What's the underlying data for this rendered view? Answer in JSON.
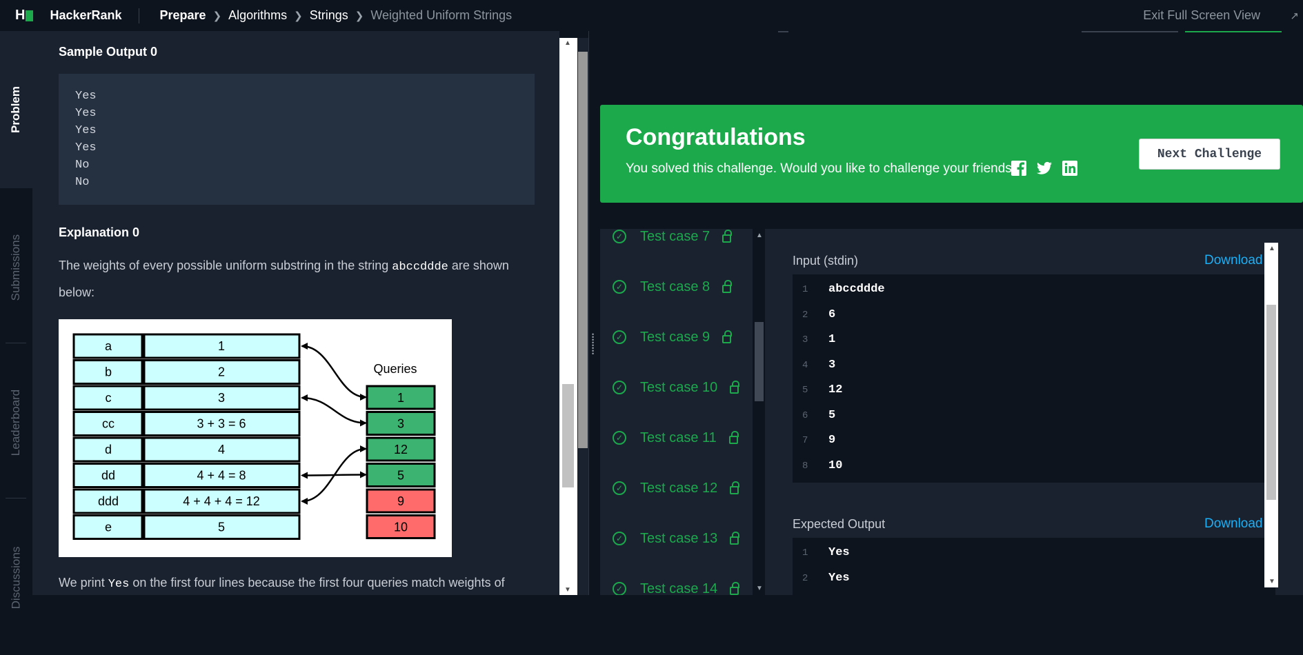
{
  "topbar": {
    "logo_letter": "H",
    "brand": "HackerRank",
    "breadcrumbs": [
      "Prepare",
      "Algorithms",
      "Strings",
      "Weighted Uniform Strings"
    ],
    "exit_fullscreen": "Exit Full Screen View"
  },
  "sidetabs": [
    "Problem",
    "Submissions",
    "Leaderboard",
    "Discussions"
  ],
  "problem": {
    "sample_output_heading": "Sample Output 0",
    "sample_output_lines": [
      "Yes",
      "Yes",
      "Yes",
      "Yes",
      "No",
      "No"
    ],
    "explanation_heading": "Explanation 0",
    "explanation_text_before": "The weights of every possible uniform substring in the string ",
    "explanation_code": "abccddde",
    "explanation_text_after": " are shown below:",
    "diagram": {
      "substrings": [
        "a",
        "b",
        "c",
        "cc",
        "d",
        "dd",
        "ddd",
        "e"
      ],
      "weights": [
        "1",
        "2",
        "3",
        "3 + 3 = 6",
        "4",
        "4 + 4 = 8",
        "4 + 4 + 4 = 12",
        "5"
      ],
      "queries_title": "Queries",
      "queries": [
        "1",
        "3",
        "12",
        "5",
        "9",
        "10"
      ],
      "query_match": [
        true,
        true,
        true,
        true,
        false,
        false
      ]
    },
    "footer_text_before": "We print ",
    "footer_code": "Yes",
    "footer_text_after": " on the first four lines because the first four queries match weights of"
  },
  "congrats": {
    "title": "Congratulations",
    "message": "You solved this challenge. Would you like to challenge your friends?",
    "social": [
      "facebook-icon",
      "twitter-icon",
      "linkedin-icon"
    ],
    "next_button": "Next Challenge"
  },
  "testcases": [
    "Test case 7",
    "Test case 8",
    "Test case 9",
    "Test case 10",
    "Test case 11",
    "Test case 12",
    "Test case 13",
    "Test case 14"
  ],
  "detail": {
    "input_label": "Input (stdin)",
    "download_label": "Download",
    "input_lines": [
      "abccddde",
      "6",
      "1",
      "3",
      "12",
      "5",
      "9",
      "10"
    ],
    "expected_label": "Expected Output",
    "expected_lines": [
      "Yes",
      "Yes"
    ]
  },
  "colors": {
    "accent_green": "#1ba94c",
    "link_blue": "#1cb0f6",
    "bg_dark": "#0e141e",
    "bg_panel": "#1a2230"
  }
}
